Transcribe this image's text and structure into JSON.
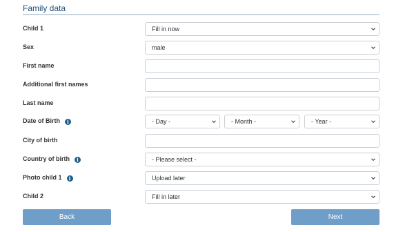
{
  "section": {
    "title": "Family data"
  },
  "form": {
    "child1": {
      "label": "Child 1",
      "value": "Fill in now"
    },
    "sex": {
      "label": "Sex",
      "value": "male"
    },
    "first_name": {
      "label": "First name",
      "value": ""
    },
    "additional_first_names": {
      "label": "Additional first names",
      "value": ""
    },
    "last_name": {
      "label": "Last name",
      "value": ""
    },
    "dob": {
      "label": "Date of Birth",
      "day": "- Day -",
      "month": "- Month -",
      "year": "- Year -"
    },
    "city_of_birth": {
      "label": "City of birth",
      "value": ""
    },
    "country_of_birth": {
      "label": "Country of birth",
      "value": "- Please select -"
    },
    "photo_child1": {
      "label": "Photo child 1",
      "value": "Upload later"
    },
    "child2": {
      "label": "Child 2",
      "value": "Fill in later"
    }
  },
  "buttons": {
    "back": "Back",
    "next": "Next"
  },
  "colors": {
    "accent": "#6f9fc8",
    "title": "#1f4d78",
    "info_icon": "#1f5f8b"
  }
}
